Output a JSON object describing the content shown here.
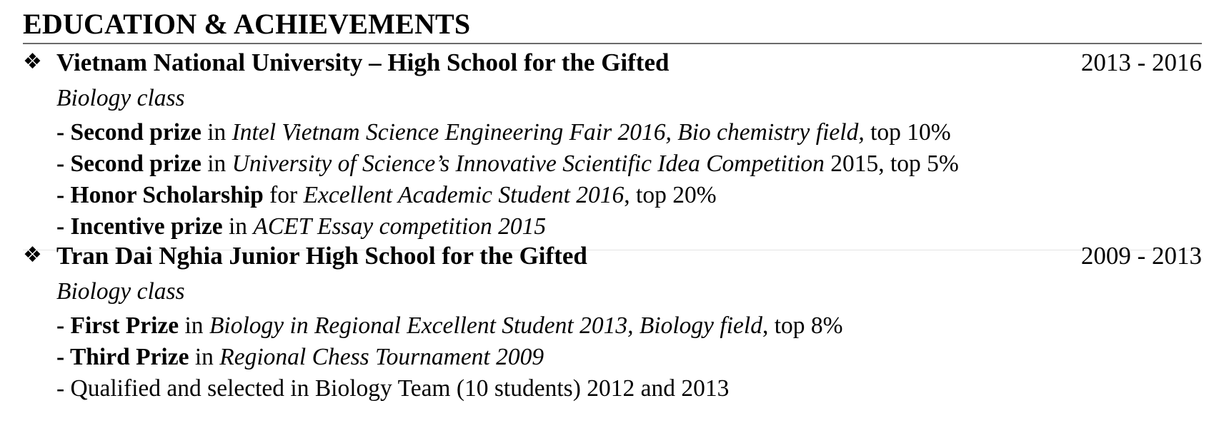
{
  "section": {
    "title": "EDUCATION & ACHIEVEMENTS"
  },
  "entries": [
    {
      "bullet": "❖",
      "school": "Vietnam National University – High School for the Gifted",
      "dates": "2013 - 2016",
      "subtitle": "Biology class",
      "items": [
        {
          "dash": "- ",
          "bold": "Second prize",
          "pre": " in ",
          "ital": "Intel Vietnam Science Engineering Fair 2016, Bio chemistry field,",
          "post": "  top 10%"
        },
        {
          "dash": "- ",
          "bold": "Second prize",
          "pre": " in ",
          "ital": "University of Science’s Innovative Scientific Idea Competition",
          "post": " 2015, top 5%"
        },
        {
          "dash": "- ",
          "bold": "Honor Scholarship",
          "pre": "  for ",
          "ital": "Excellent Academic Student 2016",
          "post": ", top 20%"
        },
        {
          "dash": "- ",
          "bold": "Incentive prize",
          "pre": " in ",
          "ital": "ACET Essay competition 2015",
          "post": ""
        }
      ]
    },
    {
      "bullet": "❖",
      "school": "Tran Dai Nghia Junior High School for the Gifted",
      "dates": "2009 - 2013",
      "subtitle": "Biology class",
      "items": [
        {
          "dash": "- ",
          "bold": "First Prize",
          "pre": " in ",
          "ital": "Biology in Regional Excellent Student 2013, Biology field",
          "post": ", top 8%"
        },
        {
          "dash": "- ",
          "bold": "Third Prize",
          "pre": " in ",
          "ital": "Regional Chess Tournament 2009",
          "post": ""
        },
        {
          "dash": "",
          "bold": "",
          "pre": "- Qualified and selected in Biology Team (10 students) 2012 and 2013",
          "ital": "",
          "post": ""
        }
      ]
    }
  ]
}
